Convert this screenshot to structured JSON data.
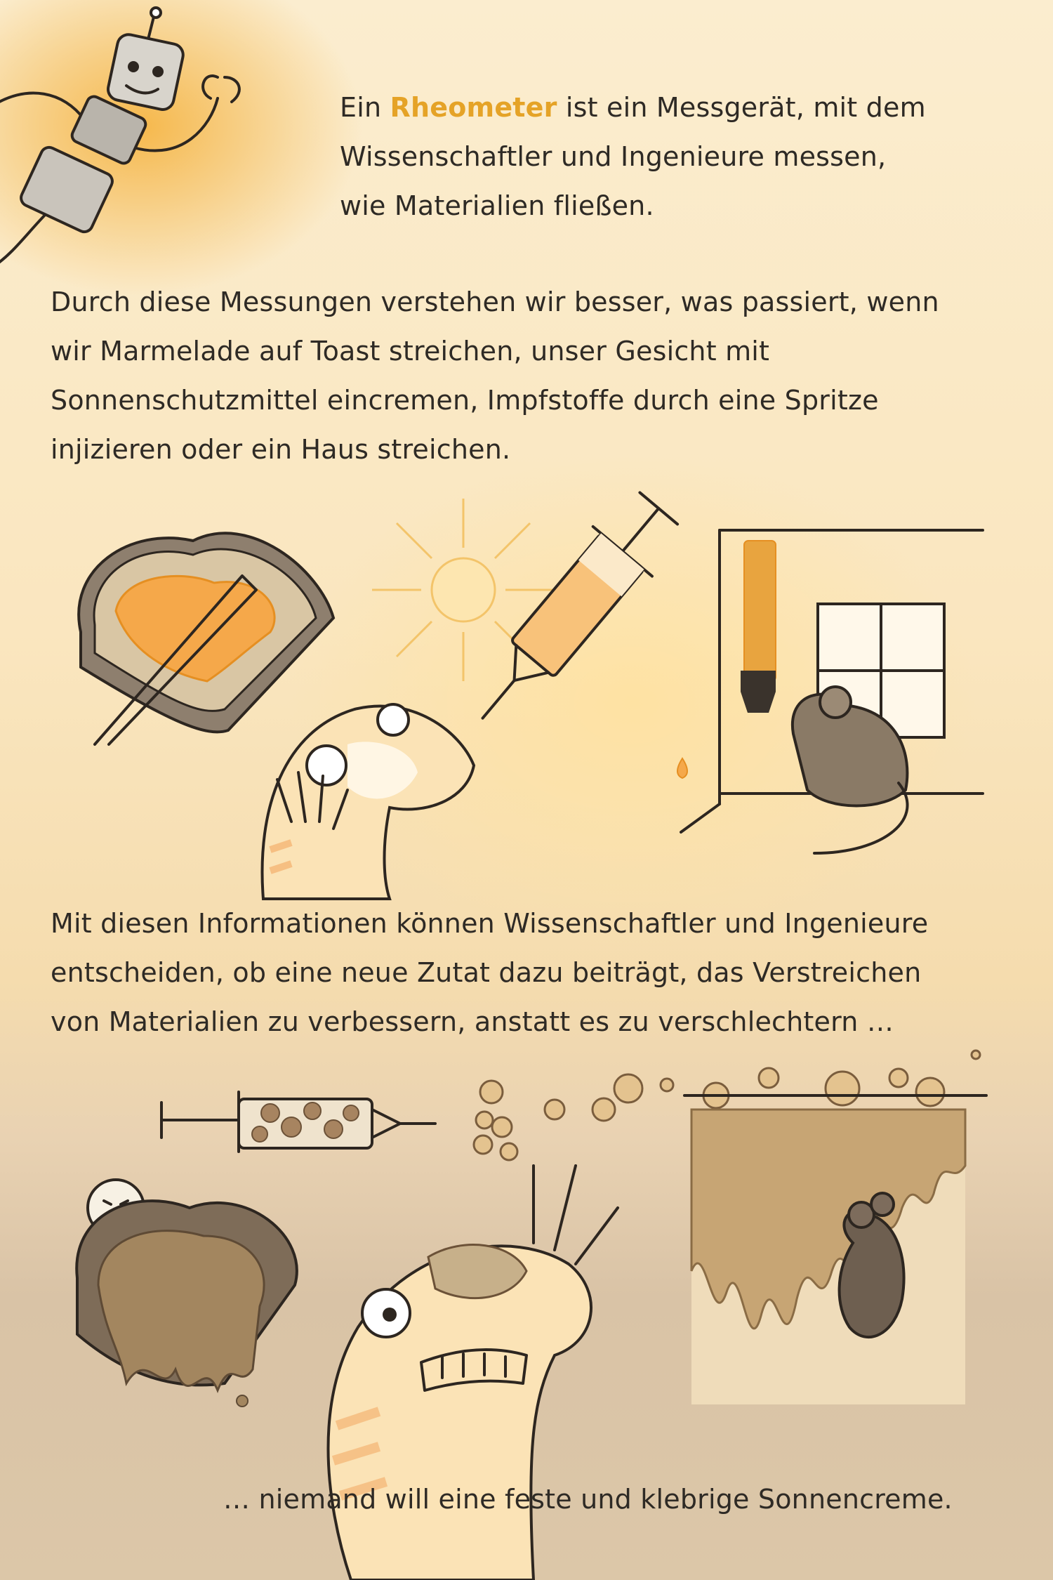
{
  "intro": {
    "before": "Ein ",
    "keyword": "Rheometer",
    "after": " ist ein Messgerät, mit dem",
    "line2": "Wissenschaftler und Ingenieure messen,",
    "line3": "wie Materialien fließen."
  },
  "paragraph2": [
    "Durch diese Messungen verstehen wir besser, was passiert, wenn",
    "wir Marmelade auf Toast streichen, unser Gesicht mit",
    "Sonnenschutzmittel eincremen, Impfstoffe durch eine Spritze",
    "injizieren oder ein Haus streichen."
  ],
  "paragraph3": [
    "Mit diesen Informationen können Wissenschaftler und Ingenieure",
    "entscheiden, ob eine neue Zutat dazu beiträgt, das Verstreichen",
    "von Materialien zu verbessern, anstatt es zu verschlechtern …"
  ],
  "closing": "… niemand will eine feste und klebrige Sonnencreme.",
  "colors": {
    "accent": "#e5a327",
    "ink": "#2d2620",
    "jam": "#f5a84a",
    "mud": "#9b7a55"
  },
  "illustrations": [
    "robot-icon",
    "toast-jam-icon",
    "syringe-icon",
    "lizard-sunscreen-icon",
    "mouse-painting-icon",
    "sticky-toast-icon",
    "clogged-syringe-icon",
    "lizard-sticky-icon",
    "dripping-wall-icon"
  ]
}
